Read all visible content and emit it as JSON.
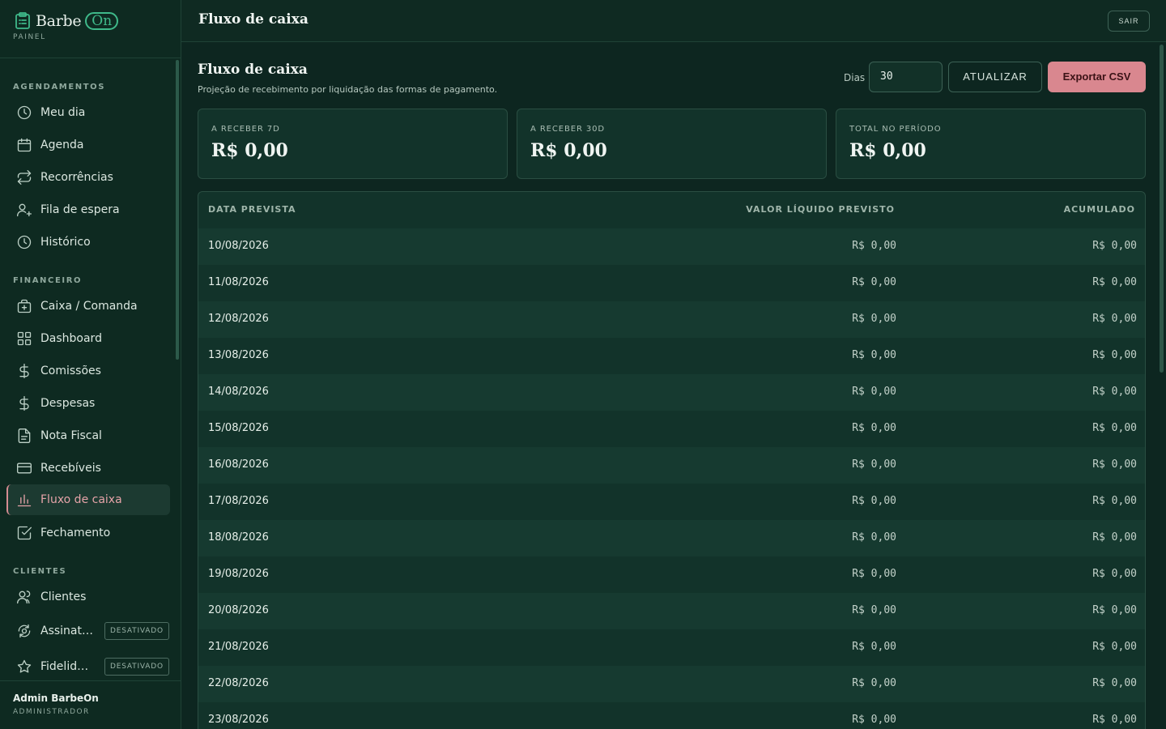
{
  "brand": {
    "name": "Barbe",
    "on": "On",
    "subtitle": "PAINEL"
  },
  "sidebar": {
    "sections": {
      "agendamentos": "AGENDAMENTOS",
      "financeiro": "FINANCEIRO",
      "clientes": "CLIENTES"
    },
    "items": {
      "meu_dia": "Meu dia",
      "agenda": "Agenda",
      "recorrencias": "Recorrências",
      "fila": "Fila de espera",
      "historico": "Histórico",
      "caixa": "Caixa / Comanda",
      "dashboard": "Dashboard",
      "comissoes": "Comissões",
      "despesas": "Despesas",
      "nota_fiscal": "Nota Fiscal",
      "recebiveis": "Recebíveis",
      "fluxo": "Fluxo de caixa",
      "fechamento": "Fechamento",
      "clientes": "Clientes",
      "assinaturas": "Assinaturas",
      "fidelidade": "Fidelidade"
    },
    "badge_disabled": "DESATIVADO",
    "active_item": "Fluxo de caixa",
    "user": {
      "name": "Admin BarbeOn",
      "role": "ADMINISTRADOR"
    }
  },
  "topbar": {
    "title": "Fluxo de caixa",
    "logout": "SAIR"
  },
  "main": {
    "title": "Fluxo de caixa",
    "subtitle": "Projeção de recebimento por liquidação das formas de pagamento.",
    "days_label": "Dias",
    "days_value": "30",
    "refresh": "ATUALIZAR",
    "export": "Exportar CSV",
    "stats": [
      {
        "label": "A RECEBER 7D",
        "value": "R$ 0,00"
      },
      {
        "label": "A RECEBER 30D",
        "value": "R$ 0,00"
      },
      {
        "label": "TOTAL NO PERÍODO",
        "value": "R$ 0,00"
      }
    ],
    "table": {
      "headers": {
        "date": "DATA PREVISTA",
        "value": "VALOR LÍQUIDO PREVISTO",
        "acc": "ACUMULADO"
      },
      "rows": [
        {
          "date": "10/08/2026",
          "value": "R$ 0,00",
          "acc": "R$ 0,00"
        },
        {
          "date": "11/08/2026",
          "value": "R$ 0,00",
          "acc": "R$ 0,00"
        },
        {
          "date": "12/08/2026",
          "value": "R$ 0,00",
          "acc": "R$ 0,00"
        },
        {
          "date": "13/08/2026",
          "value": "R$ 0,00",
          "acc": "R$ 0,00"
        },
        {
          "date": "14/08/2026",
          "value": "R$ 0,00",
          "acc": "R$ 0,00"
        },
        {
          "date": "15/08/2026",
          "value": "R$ 0,00",
          "acc": "R$ 0,00"
        },
        {
          "date": "16/08/2026",
          "value": "R$ 0,00",
          "acc": "R$ 0,00"
        },
        {
          "date": "17/08/2026",
          "value": "R$ 0,00",
          "acc": "R$ 0,00"
        },
        {
          "date": "18/08/2026",
          "value": "R$ 0,00",
          "acc": "R$ 0,00"
        },
        {
          "date": "19/08/2026",
          "value": "R$ 0,00",
          "acc": "R$ 0,00"
        },
        {
          "date": "20/08/2026",
          "value": "R$ 0,00",
          "acc": "R$ 0,00"
        },
        {
          "date": "21/08/2026",
          "value": "R$ 0,00",
          "acc": "R$ 0,00"
        },
        {
          "date": "22/08/2026",
          "value": "R$ 0,00",
          "acc": "R$ 0,00"
        },
        {
          "date": "23/08/2026",
          "value": "R$ 0,00",
          "acc": "R$ 0,00"
        }
      ]
    }
  }
}
